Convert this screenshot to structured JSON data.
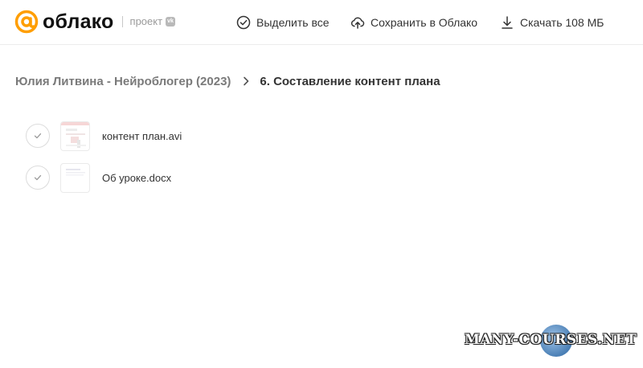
{
  "header": {
    "logo_text": "облако",
    "project_label": "проект",
    "vk_badge": "vk"
  },
  "toolbar": {
    "select_all_label": "Выделить все",
    "save_label": "Сохранить в Облако",
    "download_label": "Скачать 108 МБ"
  },
  "breadcrumb": {
    "parent": "Юлия Литвина - Нейроблогер (2023)",
    "current": "6. Составление контент плана"
  },
  "files": [
    {
      "name": "контент план.avi",
      "icon": "video-thumbnail"
    },
    {
      "name": "Об уроке.docx",
      "icon": "document-thumbnail"
    }
  ],
  "watermark": {
    "text": "MANY-COURSES.NET"
  },
  "colors": {
    "brand_orange": "#ff9e00",
    "text": "#333333",
    "muted": "#7a7a7a"
  }
}
